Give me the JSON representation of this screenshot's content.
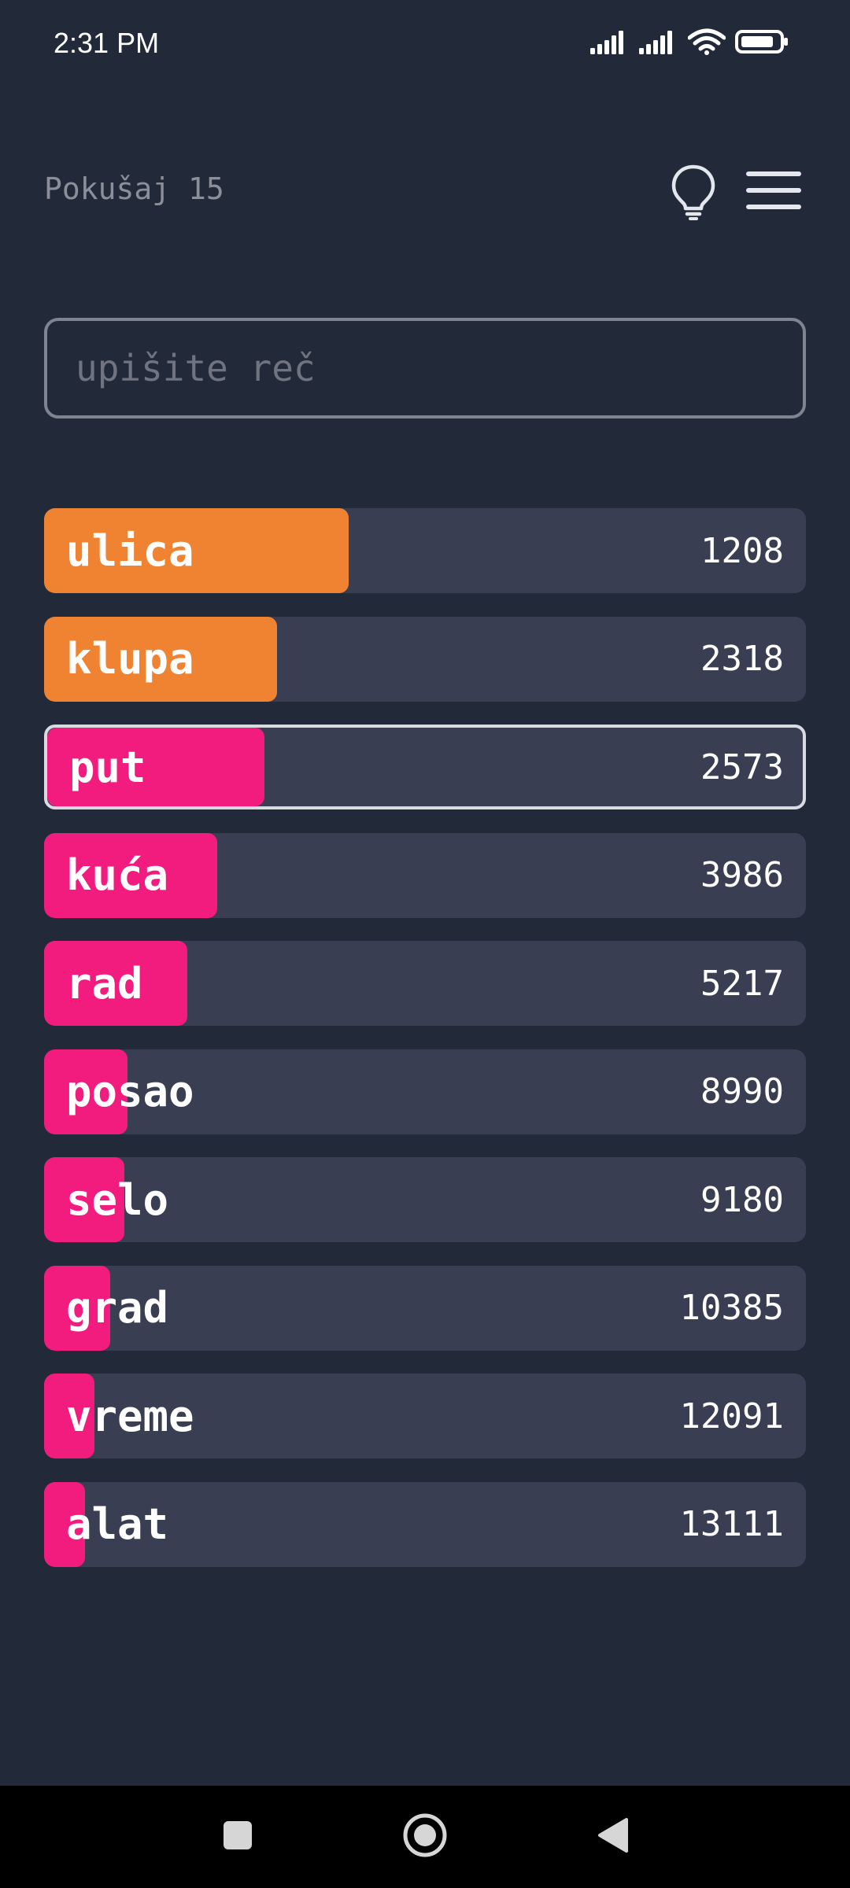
{
  "status_bar": {
    "time": "2:31 PM",
    "icons": [
      "signal-icon",
      "signal-icon",
      "wifi-icon",
      "battery-icon"
    ]
  },
  "header": {
    "attempt_label": "Pokušaj 15",
    "hint_icon": "lightbulb-icon",
    "menu_icon": "hamburger-menu-icon"
  },
  "input": {
    "placeholder": "upišite reč",
    "value": ""
  },
  "colors": {
    "background": "#222938",
    "row_background": "#3a3e52",
    "close": "#ef8332",
    "far": "#f21c7e"
  },
  "guesses": [
    {
      "word": "ulica",
      "rank": "1208",
      "fill": 0.4,
      "color": "#ef8332",
      "highlighted": false
    },
    {
      "word": "klupa",
      "rank": "2318",
      "fill": 0.306,
      "color": "#ef8332",
      "highlighted": false
    },
    {
      "word": "put",
      "rank": "2573",
      "fill": 0.288,
      "color": "#f21c7e",
      "highlighted": true
    },
    {
      "word": "kuća",
      "rank": "3986",
      "fill": 0.227,
      "color": "#f21c7e",
      "highlighted": false
    },
    {
      "word": "rad",
      "rank": "5217",
      "fill": 0.188,
      "color": "#f21c7e",
      "highlighted": false
    },
    {
      "word": "posao",
      "rank": "8990",
      "fill": 0.109,
      "color": "#f21c7e",
      "highlighted": false
    },
    {
      "word": "selo",
      "rank": "9180",
      "fill": 0.105,
      "color": "#f21c7e",
      "highlighted": false
    },
    {
      "word": "grad",
      "rank": "10385",
      "fill": 0.087,
      "color": "#f21c7e",
      "highlighted": false
    },
    {
      "word": "vreme",
      "rank": "12091",
      "fill": 0.066,
      "color": "#f21c7e",
      "highlighted": false
    },
    {
      "word": "alat",
      "rank": "13111",
      "fill": 0.054,
      "color": "#f21c7e",
      "highlighted": false
    }
  ],
  "nav_bar": {
    "buttons": [
      "recents-square-icon",
      "home-circle-icon",
      "back-triangle-icon"
    ]
  }
}
